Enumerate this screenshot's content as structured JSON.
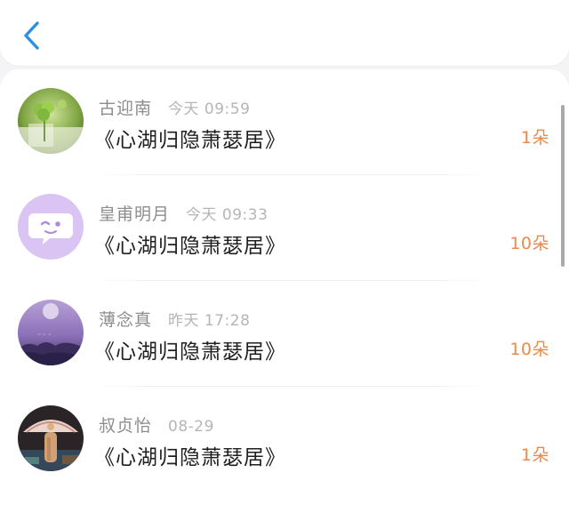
{
  "header": {
    "back_icon": "chevron-left-icon",
    "accent_color": "#2d8fe0"
  },
  "list": {
    "items": [
      {
        "name": "古迎南",
        "time": "今天 09:59",
        "title": "《心湖归隐萧瑟居》",
        "count": "1朵",
        "avatar": "clover-photo"
      },
      {
        "name": "皇甫明月",
        "time": "今天 09:33",
        "title": "《心湖归隐萧瑟居》",
        "count": "10朵",
        "avatar": "chat-bubble-wink"
      },
      {
        "name": "薄念真",
        "time": "昨天 17:28",
        "title": "《心湖归隐萧瑟居》",
        "count": "10朵",
        "avatar": "purple-moon-photo"
      },
      {
        "name": "叔贞怡",
        "time": "08-29",
        "title": "《心湖归隐萧瑟居》",
        "count": "1朵",
        "avatar": "mushroom-photo"
      }
    ]
  },
  "colors": {
    "count": "#ec8a4a",
    "name": "#8d8d8d",
    "time": "#b5b5b5",
    "title": "#1f1f1f"
  }
}
